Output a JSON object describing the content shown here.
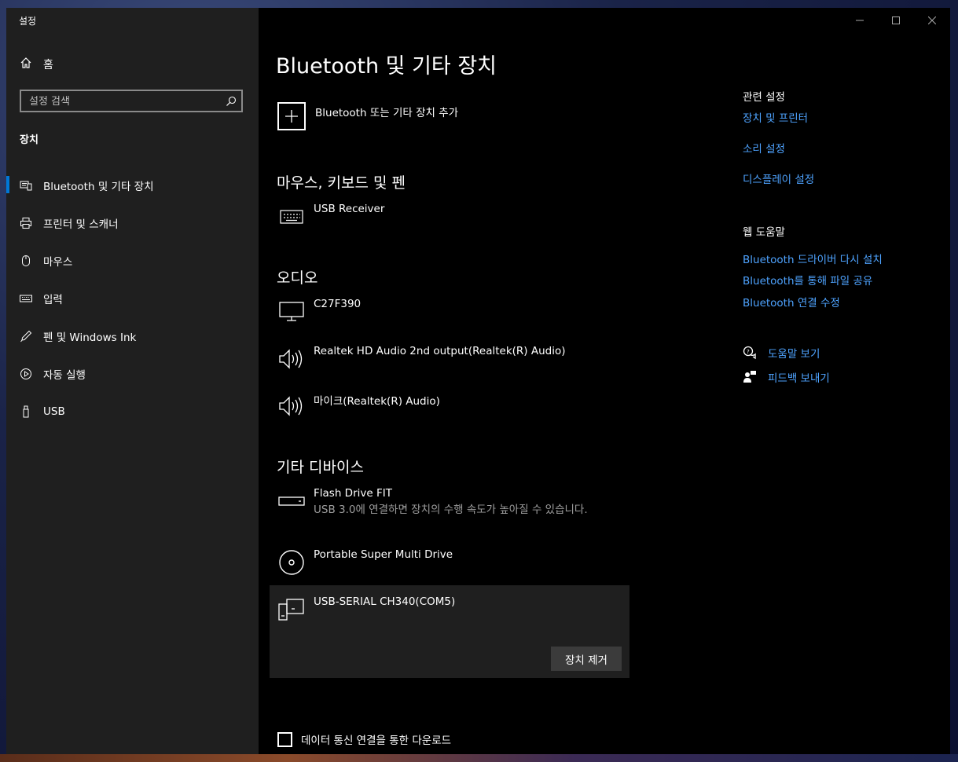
{
  "window": {
    "app_title": "설정",
    "controls": {
      "minimize": "—",
      "maximize": "☐",
      "close": "✕"
    }
  },
  "sidebar": {
    "home_label": "홈",
    "search_placeholder": "설정 검색",
    "section_label": "장치",
    "items": [
      {
        "label": "Bluetooth 및 기타 장치",
        "icon": "bluetooth-devices-icon",
        "active": true
      },
      {
        "label": "프린터 및 스캐너",
        "icon": "printer-icon"
      },
      {
        "label": "마우스",
        "icon": "mouse-icon"
      },
      {
        "label": "입력",
        "icon": "keyboard-icon"
      },
      {
        "label": "펜 및 Windows Ink",
        "icon": "pen-icon"
      },
      {
        "label": "자동 실행",
        "icon": "autoplay-icon"
      },
      {
        "label": "USB",
        "icon": "usb-icon"
      }
    ]
  },
  "main": {
    "title": "Bluetooth 및 기타 장치",
    "add_device_label": "Bluetooth 또는 기타 장치 추가",
    "groups": {
      "input": {
        "title": "마우스, 키보드 및 펜",
        "devices": [
          {
            "name": "USB Receiver",
            "icon": "keyboard-icon"
          }
        ]
      },
      "audio": {
        "title": "오디오",
        "devices": [
          {
            "name": "C27F390",
            "icon": "monitor-icon"
          },
          {
            "name": "Realtek HD Audio 2nd output(Realtek(R) Audio)",
            "icon": "speaker-icon"
          },
          {
            "name": "마이크(Realtek(R) Audio)",
            "icon": "speaker-icon"
          }
        ]
      },
      "other": {
        "title": "기타 디바이스",
        "devices": [
          {
            "name": "Flash Drive FIT",
            "sub": "USB 3.0에 연결하면 장치의 수행 속도가 높아질 수 있습니다.",
            "icon": "usb-drive-icon"
          },
          {
            "name": "Portable Super Multi Drive",
            "icon": "disc-drive-icon"
          },
          {
            "name": "USB-SERIAL CH340(COM5)",
            "icon": "generic-device-icon",
            "selected": true
          }
        ]
      }
    },
    "remove_button_label": "장치 제거",
    "metered_label": "데이터 통신 연결을 통한 다운로드",
    "metered_checked": false
  },
  "right": {
    "related_title": "관련 설정",
    "related_links": [
      "장치 및 프린터",
      "소리 설정",
      "디스플레이 설정"
    ],
    "web_help_title": "웹 도움말",
    "web_help_links": [
      "Bluetooth 드라이버 다시 설치",
      "Bluetooth를 통해 파일 공유",
      "Bluetooth 연결 수정"
    ],
    "get_help_label": "도움말 보기",
    "feedback_label": "피드백 보내기"
  },
  "colors": {
    "accent": "#0078d7",
    "link": "#4ea3ff",
    "sidebar_bg": "#1f1f1f",
    "main_bg": "#000000"
  }
}
